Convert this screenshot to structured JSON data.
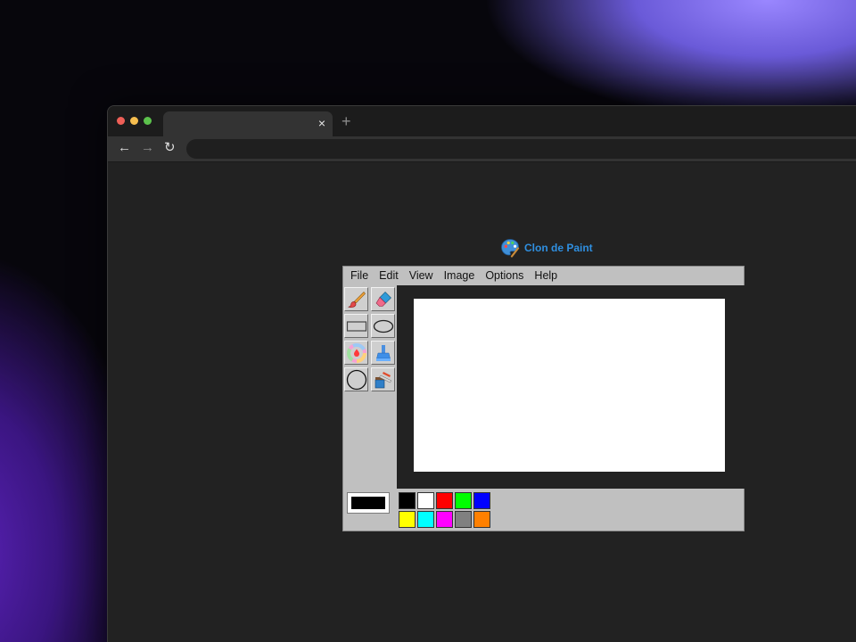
{
  "browser": {
    "tab_close_glyph": "×",
    "new_tab_glyph": "+",
    "back_glyph": "←",
    "forward_glyph": "→",
    "reload_glyph": "↻",
    "url": ""
  },
  "app": {
    "title": "Clon de Paint",
    "logo_icon": "palette-icon"
  },
  "menu": {
    "items": [
      {
        "label": "File"
      },
      {
        "label": "Edit"
      },
      {
        "label": "View"
      },
      {
        "label": "Image"
      },
      {
        "label": "Options"
      },
      {
        "label": "Help"
      }
    ]
  },
  "tools": [
    {
      "icon": "brush-icon"
    },
    {
      "icon": "eraser-icon"
    },
    {
      "icon": "rectangle-icon"
    },
    {
      "icon": "ellipse-icon"
    },
    {
      "icon": "color-picker-icon"
    },
    {
      "icon": "fill-bucket-icon"
    },
    {
      "icon": "circle-icon"
    },
    {
      "icon": "paint-roller-icon"
    }
  ],
  "current_color": "#000000",
  "palette": [
    {
      "name": "black",
      "hex": "#000000"
    },
    {
      "name": "white",
      "hex": "#ffffff"
    },
    {
      "name": "red",
      "hex": "#ff0000"
    },
    {
      "name": "green",
      "hex": "#00ff00"
    },
    {
      "name": "blue",
      "hex": "#0000ff"
    },
    {
      "name": "yellow",
      "hex": "#ffff00"
    },
    {
      "name": "cyan",
      "hex": "#00ffff"
    },
    {
      "name": "magenta",
      "hex": "#ff00ff"
    },
    {
      "name": "gray",
      "hex": "#808080"
    },
    {
      "name": "orange",
      "hex": "#ff8000"
    }
  ]
}
